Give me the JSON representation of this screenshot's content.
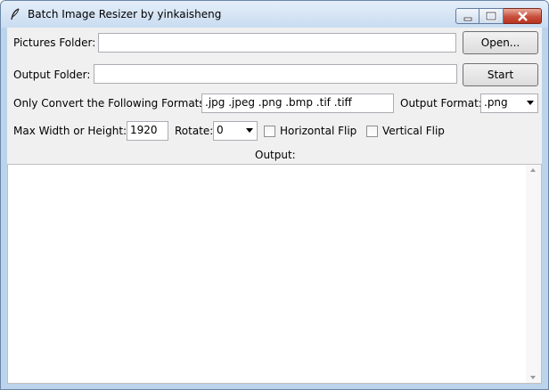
{
  "window": {
    "title": "Batch Image Resizer by yinkaisheng"
  },
  "pictures_folder": {
    "label": "Pictures Folder:",
    "value": "",
    "button": "Open..."
  },
  "output_folder": {
    "label": "Output Folder:",
    "value": "",
    "button": "Start"
  },
  "formats": {
    "label": "Only Convert the Following Formats:",
    "value": ".jpg .jpeg .png .bmp .tif .tiff",
    "output_label": "Output Format:",
    "output_value": ".png"
  },
  "options": {
    "max_label": "Max Width or Height:",
    "max_value": "1920",
    "rotate_label": "Rotate:",
    "rotate_value": "0",
    "hflip_label": "Horizontal Flip",
    "vflip_label": "Vertical Flip"
  },
  "output": {
    "label": "Output:",
    "text": ""
  },
  "icons": [
    "feather-icon",
    "minimize-icon",
    "maximize-icon",
    "close-icon",
    "dropdown-arrow-icon",
    "scroll-up-icon",
    "scroll-down-icon"
  ],
  "colors": {
    "title_bar": "#c9dcf1",
    "window_body": "#f0f0f0",
    "close_button": "#c7503d"
  }
}
